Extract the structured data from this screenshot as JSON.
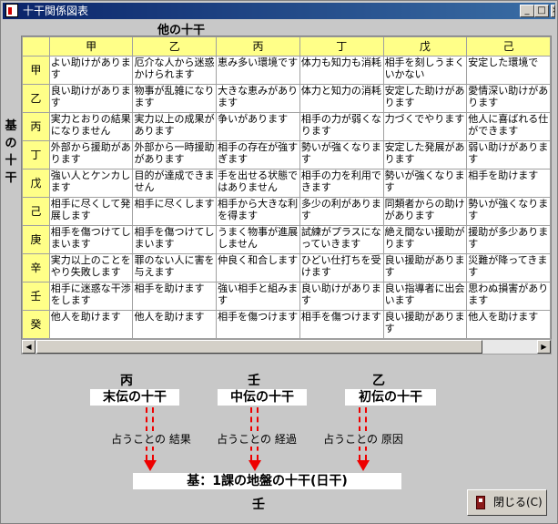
{
  "window": {
    "title": "十干関係図表"
  },
  "title_buttons": {
    "minimize": "_",
    "maximize": "□",
    "close": "×"
  },
  "labels": {
    "others": "他の十干",
    "base": "基の十干"
  },
  "table": {
    "columns": [
      "甲",
      "乙",
      "丙",
      "丁",
      "戊",
      "己"
    ],
    "rows": [
      {
        "head": "甲",
        "cells": [
          "よい助けがあります",
          "厄介な人から迷惑かけられます",
          "恵み多い環境です",
          "体力も知力も消耗",
          "相手を刻しうまくいかない",
          "安定した環境で"
        ]
      },
      {
        "head": "乙",
        "cells": [
          "良い助けがあります",
          "物事が乱雑になります",
          "大きな恵みがあります",
          "体力と知力の消耗",
          "安定した助けがあります",
          "愛情深い助けがあります"
        ]
      },
      {
        "head": "丙",
        "cells": [
          "実力とおりの結果になりません",
          "実力以上の成果があります",
          "争いがあります",
          "相手の力が弱くなります",
          "力づくでやります",
          "他人に喜ばれる仕ができます"
        ]
      },
      {
        "head": "丁",
        "cells": [
          "外部から援助があります",
          "外部から一時援助があります",
          "相手の存在が強すぎます",
          "勢いが強くなります",
          "安定した発展があります",
          "弱い助けがあります"
        ]
      },
      {
        "head": "戊",
        "cells": [
          "強い人とケンカします",
          "目的が達成できません",
          "手を出せる状態ではありません",
          "相手の力を利用できます",
          "勢いが強くなります",
          "相手を助けます"
        ]
      },
      {
        "head": "己",
        "cells": [
          "相手に尽くして発展します",
          "相手に尽くします",
          "相手から大きな利を得ます",
          "多少の利があります",
          "同類者からの助けがあります",
          "勢いが強くなります"
        ]
      },
      {
        "head": "庚",
        "cells": [
          "相手を傷つけてしまいます",
          "相手を傷つけてしまいます",
          "うまく物事が進展しません",
          "試練がプラスになっていきます",
          "絶え間ない援助がります",
          "援助が多少あります"
        ]
      },
      {
        "head": "辛",
        "cells": [
          "実力以上のことをやり失敗します",
          "罪のない人に害を与えます",
          "仲良く和合します",
          "ひどい仕打ちを受けます",
          "良い援助があります",
          "災難が降ってきます"
        ]
      },
      {
        "head": "壬",
        "cells": [
          "相手に迷惑な干渉をします",
          "相手を助けます",
          "強い相手と組みます",
          "良い助けがあります",
          "良い指導者に出会います",
          "思わぬ損害があります"
        ]
      },
      {
        "head": "癸",
        "cells": [
          "他人を助けます",
          "他人を助けます",
          "相手を傷つけます",
          "相手を傷つけます",
          "良い援助があります",
          "他人を助けます"
        ]
      }
    ]
  },
  "scrollbar": {
    "left_arrow": "◀",
    "right_arrow": "▶"
  },
  "diagram": {
    "stems": [
      {
        "stem": "丙",
        "label": "末伝の十干",
        "meaning": "占うことの 結果"
      },
      {
        "stem": "壬",
        "label": "中伝の十干",
        "meaning": "占うことの 経過"
      },
      {
        "stem": "乙",
        "label": "初伝の十干",
        "meaning": "占うことの 原因"
      }
    ],
    "base_label": "基：1課の地盤の十干(日干)",
    "base_stem": "壬"
  },
  "close_button": {
    "label": "閉じる(C)"
  },
  "colors": {
    "header": "#ffff88",
    "arrow": "#e00000",
    "title_bar": "#0a246a"
  }
}
